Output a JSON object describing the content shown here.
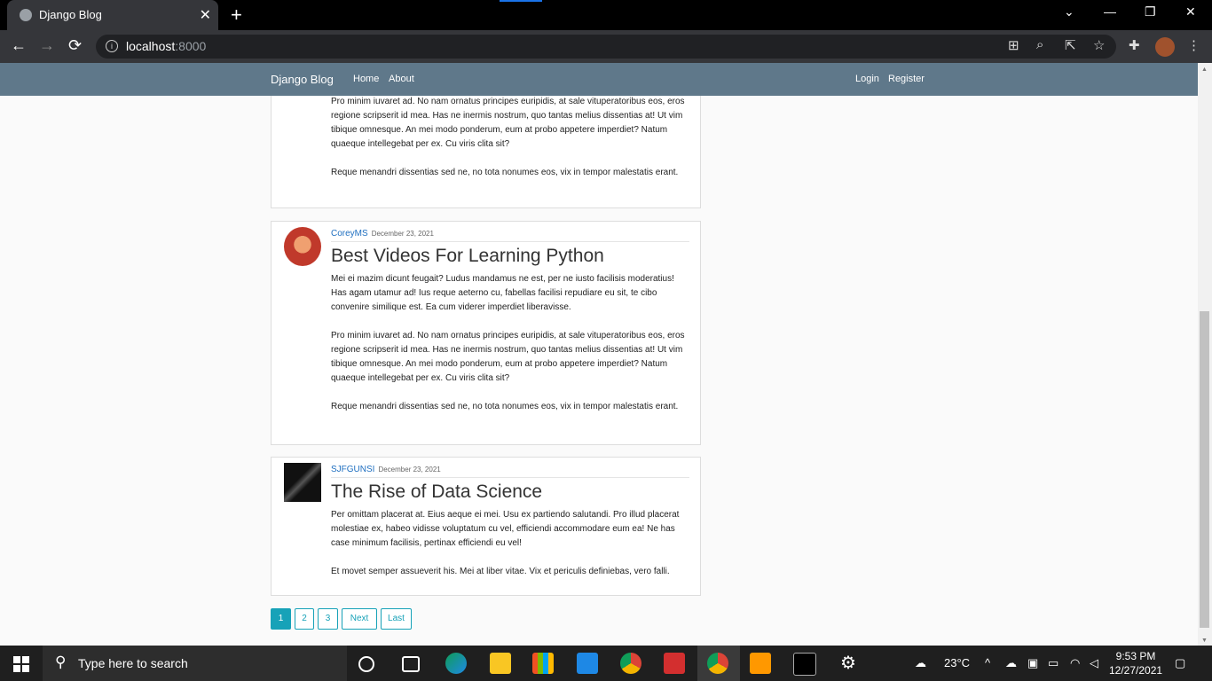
{
  "browser": {
    "tab_title": "Django Blog",
    "close_glyph": "✕",
    "newtab_glyph": "+",
    "url_host": "localhost",
    "url_port": ":8000",
    "controls": {
      "minimize": "—",
      "maximize": "❐",
      "close": "✕",
      "chevron": "⌄"
    },
    "nav": {
      "back": "←",
      "forward": "→",
      "reload": "⟳"
    }
  },
  "site": {
    "brand": "Django Blog",
    "nav_left": [
      "Home",
      "About"
    ],
    "nav_right": [
      "Login",
      "Register"
    ]
  },
  "posts": [
    {
      "author": "",
      "date": "",
      "title": "",
      "paragraphs": [
        "Pro minim iuvaret ad. No nam ornatus principes euripidis, at sale vituperatoribus eos, eros regione scripserit id mea. Has ne inermis nostrum, quo tantas melius dissentias at! Ut vim tibique omnesque. An mei modo ponderum, eum at probo appetere imperdiet? Natum quaeque intellegebat per ex. Cu viris clita sit?",
        "Reque menandri dissentias sed ne, no tota nonumes eos, vix in tempor malestatis erant."
      ]
    },
    {
      "author": "CoreyMS",
      "date": "December 23, 2021",
      "title": "Best Videos For Learning Python",
      "paragraphs": [
        "Mei ei mazim dicunt feugait? Ludus mandamus ne est, per ne iusto facilisis moderatius! Has agam utamur ad! Ius reque aeterno cu, fabellas facilisi repudiare eu sit, te cibo convenire similique est. Ea cum viderer imperdiet liberavisse.",
        "Pro minim iuvaret ad. No nam ornatus principes euripidis, at sale vituperatoribus eos, eros regione scripserit id mea. Has ne inermis nostrum, quo tantas melius dissentias at! Ut vim tibique omnesque. An mei modo ponderum, eum at probo appetere imperdiet? Natum quaeque intellegebat per ex. Cu viris clita sit?",
        "Reque menandri dissentias sed ne, no tota nonumes eos, vix in tempor malestatis erant."
      ]
    },
    {
      "author": "SJFGUNSI",
      "date": "December 23, 2021",
      "title": "The Rise of Data Science",
      "paragraphs": [
        "Per omittam placerat at. Eius aeque ei mei. Usu ex partiendo salutandi. Pro illud placerat molestiae ex, habeo vidisse voluptatum cu vel, efficiendi accommodare eum ea! Ne has case minimum facilisis, pertinax efficiendi eu vel!",
        "Et movet semper assueverit his. Mei at liber vitae. Vix et periculis definiebas, vero falli."
      ]
    }
  ],
  "pagination": {
    "pages": [
      "1",
      "2",
      "3"
    ],
    "next": "Next",
    "last": "Last",
    "active": "1"
  },
  "taskbar": {
    "search_placeholder": "Type here to search",
    "temperature": "23°C",
    "time": "9:53 PM",
    "date": "12/27/2021"
  }
}
